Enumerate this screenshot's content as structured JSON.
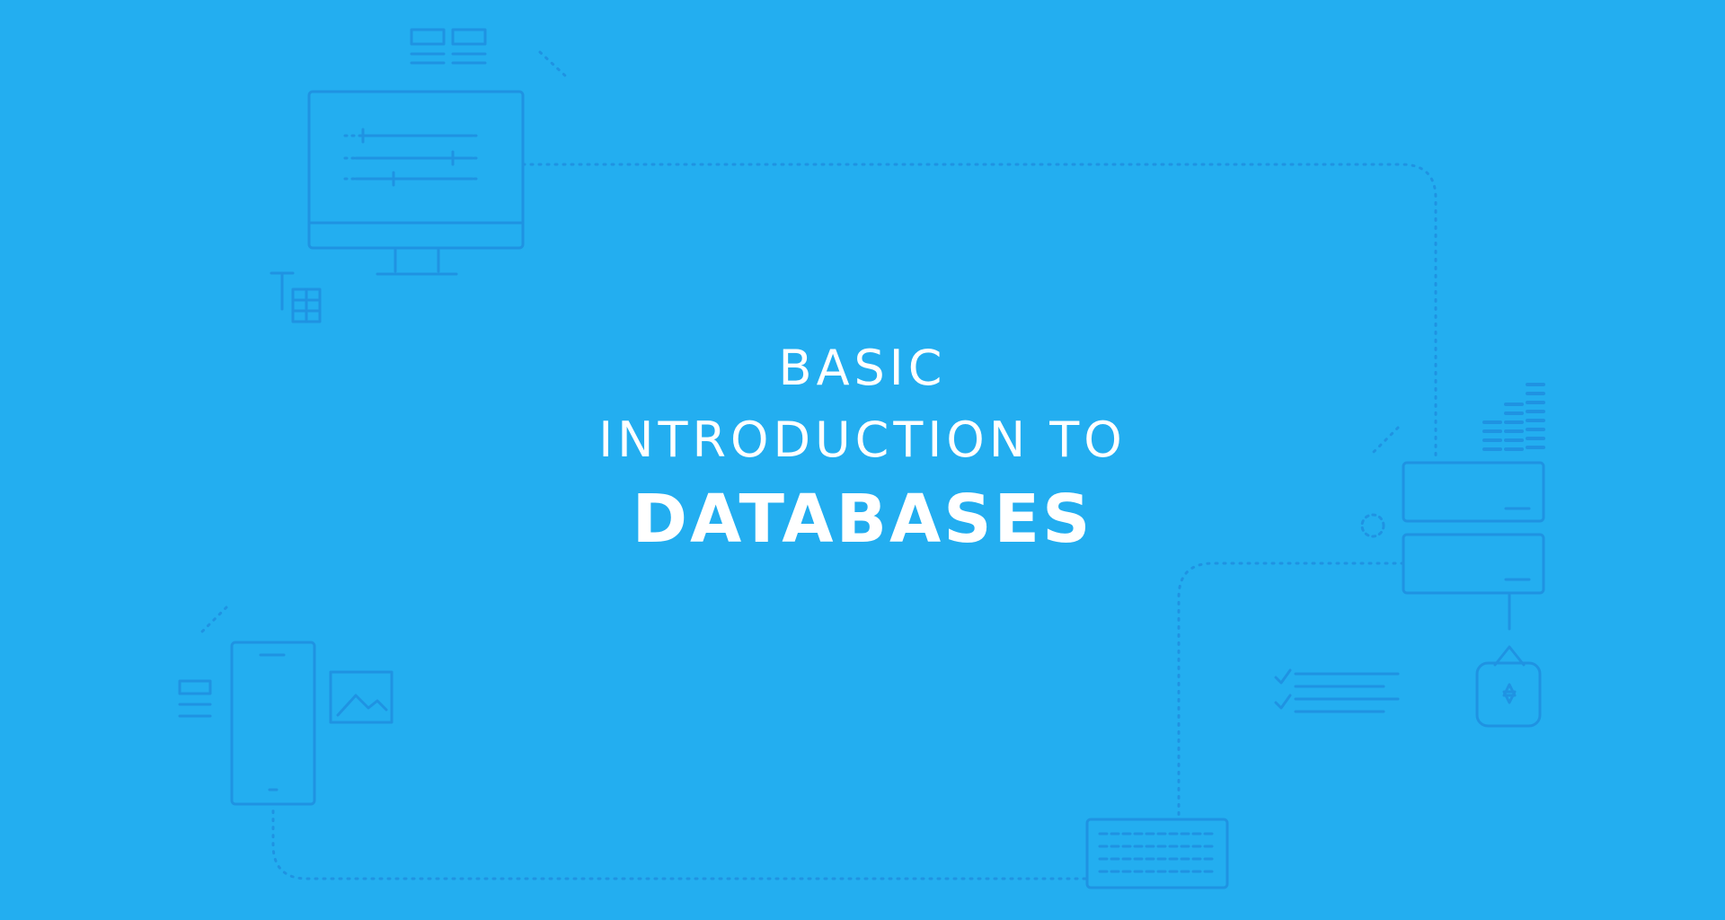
{
  "title": {
    "line1": "BASIC",
    "line2": "INTRODUCTION TO",
    "line3": "DATABASES"
  },
  "colors": {
    "background": "#23aef0",
    "line_art": "#1f8fe0",
    "text": "#ffffff"
  },
  "icons": [
    "desktop-monitor-icon",
    "layout-grid-icon",
    "text-table-icon",
    "mobile-phone-icon",
    "image-icon",
    "text-list-icon",
    "server-stack-icon",
    "bar-chart-icon",
    "checklist-icon",
    "padlock-icon",
    "keyboard-icon"
  ]
}
